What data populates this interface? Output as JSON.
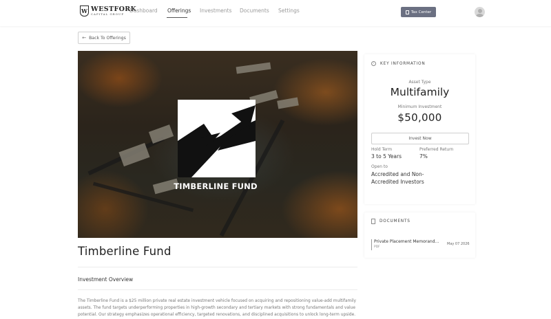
{
  "header": {
    "logo_name": "WESTFORK",
    "logo_sub": "CAPITAL GROUP",
    "logo_mark": "W",
    "nav": [
      {
        "label": "Dashboard",
        "active": false
      },
      {
        "label": "Offerings",
        "active": true
      },
      {
        "label": "Investments",
        "active": false
      },
      {
        "label": "Documents",
        "active": false
      },
      {
        "label": "Settings",
        "active": false
      }
    ],
    "tax_center_label": "Tax Center"
  },
  "back_button": {
    "label": "Back To Offerings",
    "icon": "arrow-left-icon"
  },
  "hero": {
    "fund_name": "TIMBERLINE FUND",
    "logo_icon": "mountain-arrow-icon"
  },
  "fund": {
    "title": "Timberline Fund",
    "overview_heading": "Investment Overview",
    "overview_text": "The Timberline Fund is a $25 million private real estate investment vehicle focused on acquiring and repositioning value-add multifamily assets. The fund targets underperforming properties in high-growth secondary and tertiary markets with strong fundamentals and value potential. Our strategy emphasizes operational efficiency, targeted renovations, and disciplined acquisitions to unlock long-term upside."
  },
  "key_info": {
    "heading": "KEY INFORMATION",
    "asset_type_label": "Asset Type",
    "asset_type_value": "Multifamily",
    "min_investment_label": "Minimum Investment",
    "min_investment_value": "$50,000",
    "invest_label": "Invest Now",
    "hold_term_label": "Hold Term",
    "hold_term_value": "3 to 5 Years",
    "preferred_return_label": "Preferred Return",
    "preferred_return_value": "7%",
    "open_to_label": "Open to",
    "open_to_value": "Accredited and Non-Accredited Investors"
  },
  "documents": {
    "heading": "DOCUMENTS",
    "items": [
      {
        "name": "Private Placement Memorand...",
        "type": "PDF",
        "date": "May 07 2026"
      }
    ]
  },
  "colors": {
    "tax_button": "#6b7082",
    "nav_active": "#333333",
    "nav_inactive": "#9a9a9a"
  }
}
